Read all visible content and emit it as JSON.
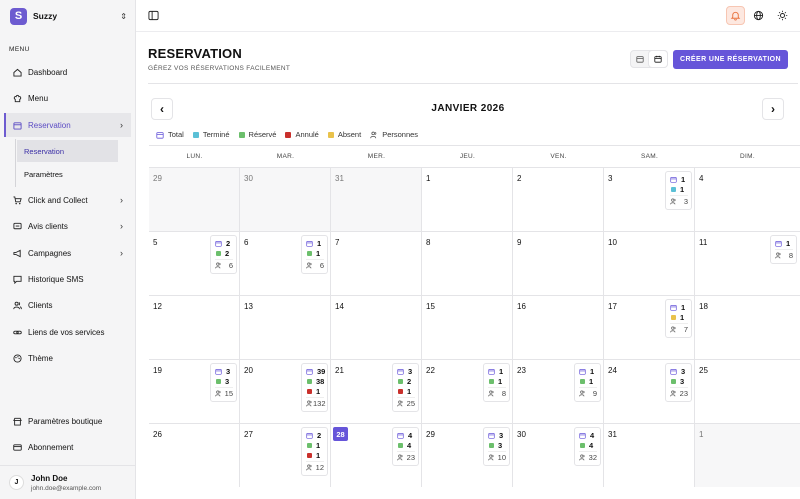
{
  "brand": {
    "name": "Suzzy",
    "logo_letter": "S",
    "accent": "#6655d9"
  },
  "sidebar": {
    "menu_label": "MENU",
    "items": [
      {
        "label": "Dashboard",
        "icon": "home-icon"
      },
      {
        "label": "Menu",
        "icon": "chef-hat-icon"
      },
      {
        "label": "Reservation",
        "icon": "calendar-icon"
      },
      {
        "label": "Click and Collect",
        "icon": "cart-icon"
      },
      {
        "label": "Avis clients",
        "icon": "message-icon"
      },
      {
        "label": "Campagnes",
        "icon": "megaphone-icon"
      },
      {
        "label": "Historique SMS",
        "icon": "chat-icon"
      },
      {
        "label": "Clients",
        "icon": "users-icon"
      },
      {
        "label": "Liens de vos services",
        "icon": "link-icon"
      },
      {
        "label": "Thème",
        "icon": "palette-icon"
      },
      {
        "label": "Paramètres boutique",
        "icon": "store-icon"
      },
      {
        "label": "Abonnement",
        "icon": "credit-card-icon"
      }
    ],
    "sub_items": [
      {
        "label": "Reservation"
      },
      {
        "label": "Paramètres"
      }
    ]
  },
  "user": {
    "initial": "J",
    "name": "John Doe",
    "email": "john.doe@example.com"
  },
  "page": {
    "title": "RESERVATION",
    "subtitle": "GÉREZ VOS RÉSERVATIONS FACILEMENT",
    "create_button": "CRÉER UNE RÉSERVATION"
  },
  "calendar": {
    "month": "JANVIER 2026",
    "legend": [
      {
        "label": "Total",
        "color": "#6655d9"
      },
      {
        "label": "Terminé",
        "color": "#5bc0d6"
      },
      {
        "label": "Réservé",
        "color": "#6cbf6c"
      },
      {
        "label": "Annulé",
        "color": "#c9302c"
      },
      {
        "label": "Absent",
        "color": "#e9c24b"
      },
      {
        "label": "Personnes",
        "color": "#555555"
      }
    ],
    "weekdays": [
      "LUN.",
      "MAR.",
      "MER.",
      "JEU.",
      "VEN.",
      "SAM.",
      "DIM."
    ],
    "weeks": [
      [
        {
          "day": "29",
          "other": true
        },
        {
          "day": "30",
          "other": true
        },
        {
          "day": "31",
          "other": true
        },
        {
          "day": "1"
        },
        {
          "day": "2"
        },
        {
          "day": "3",
          "stats": {
            "total": "1",
            "rows": [
              {
                "status": "termine",
                "value": "1"
              }
            ],
            "persons": "3"
          }
        },
        {
          "day": "4"
        }
      ],
      [
        {
          "day": "5",
          "stats": {
            "total": "2",
            "rows": [
              {
                "status": "reserve",
                "value": "2"
              }
            ],
            "persons": "6"
          }
        },
        {
          "day": "6",
          "stats": {
            "total": "1",
            "rows": [
              {
                "status": "reserve",
                "value": "1"
              }
            ],
            "persons": "6"
          }
        },
        {
          "day": "7"
        },
        {
          "day": "8"
        },
        {
          "day": "9"
        },
        {
          "day": "10"
        },
        {
          "day": "11",
          "stats": {
            "total": "1",
            "rows": [],
            "persons": "8"
          }
        }
      ],
      [
        {
          "day": "12"
        },
        {
          "day": "13"
        },
        {
          "day": "14"
        },
        {
          "day": "15"
        },
        {
          "day": "16"
        },
        {
          "day": "17",
          "stats": {
            "total": "1",
            "rows": [
              {
                "status": "absent",
                "value": "1"
              }
            ],
            "persons": "7"
          }
        },
        {
          "day": "18"
        }
      ],
      [
        {
          "day": "19",
          "stats": {
            "total": "3",
            "rows": [
              {
                "status": "reserve",
                "value": "3"
              }
            ],
            "persons": "15"
          }
        },
        {
          "day": "20",
          "stats": {
            "total": "39",
            "rows": [
              {
                "status": "reserve",
                "value": "38"
              },
              {
                "status": "annule",
                "value": "1"
              }
            ],
            "persons": "132"
          }
        },
        {
          "day": "21",
          "stats": {
            "total": "3",
            "rows": [
              {
                "status": "reserve",
                "value": "2"
              },
              {
                "status": "annule",
                "value": "1"
              }
            ],
            "persons": "25"
          }
        },
        {
          "day": "22",
          "stats": {
            "total": "1",
            "rows": [
              {
                "status": "reserve",
                "value": "1"
              }
            ],
            "persons": "8"
          }
        },
        {
          "day": "23",
          "stats": {
            "total": "1",
            "rows": [
              {
                "status": "reserve",
                "value": "1"
              }
            ],
            "persons": "9"
          }
        },
        {
          "day": "24",
          "stats": {
            "total": "3",
            "rows": [
              {
                "status": "reserve",
                "value": "3"
              }
            ],
            "persons": "23"
          }
        },
        {
          "day": "25"
        }
      ],
      [
        {
          "day": "26"
        },
        {
          "day": "27",
          "stats": {
            "total": "2",
            "rows": [
              {
                "status": "reserve",
                "value": "1"
              },
              {
                "status": "annule",
                "value": "1"
              }
            ],
            "persons": "12"
          }
        },
        {
          "day": "28",
          "today": true,
          "stats": {
            "total": "4",
            "rows": [
              {
                "status": "reserve",
                "value": "4"
              }
            ],
            "persons": "23"
          }
        },
        {
          "day": "29",
          "stats": {
            "total": "3",
            "rows": [
              {
                "status": "reserve",
                "value": "3"
              }
            ],
            "persons": "10"
          }
        },
        {
          "day": "30",
          "stats": {
            "total": "4",
            "rows": [
              {
                "status": "reserve",
                "value": "4"
              }
            ],
            "persons": "32"
          }
        },
        {
          "day": "31"
        },
        {
          "day": "1",
          "other": true
        }
      ]
    ]
  }
}
